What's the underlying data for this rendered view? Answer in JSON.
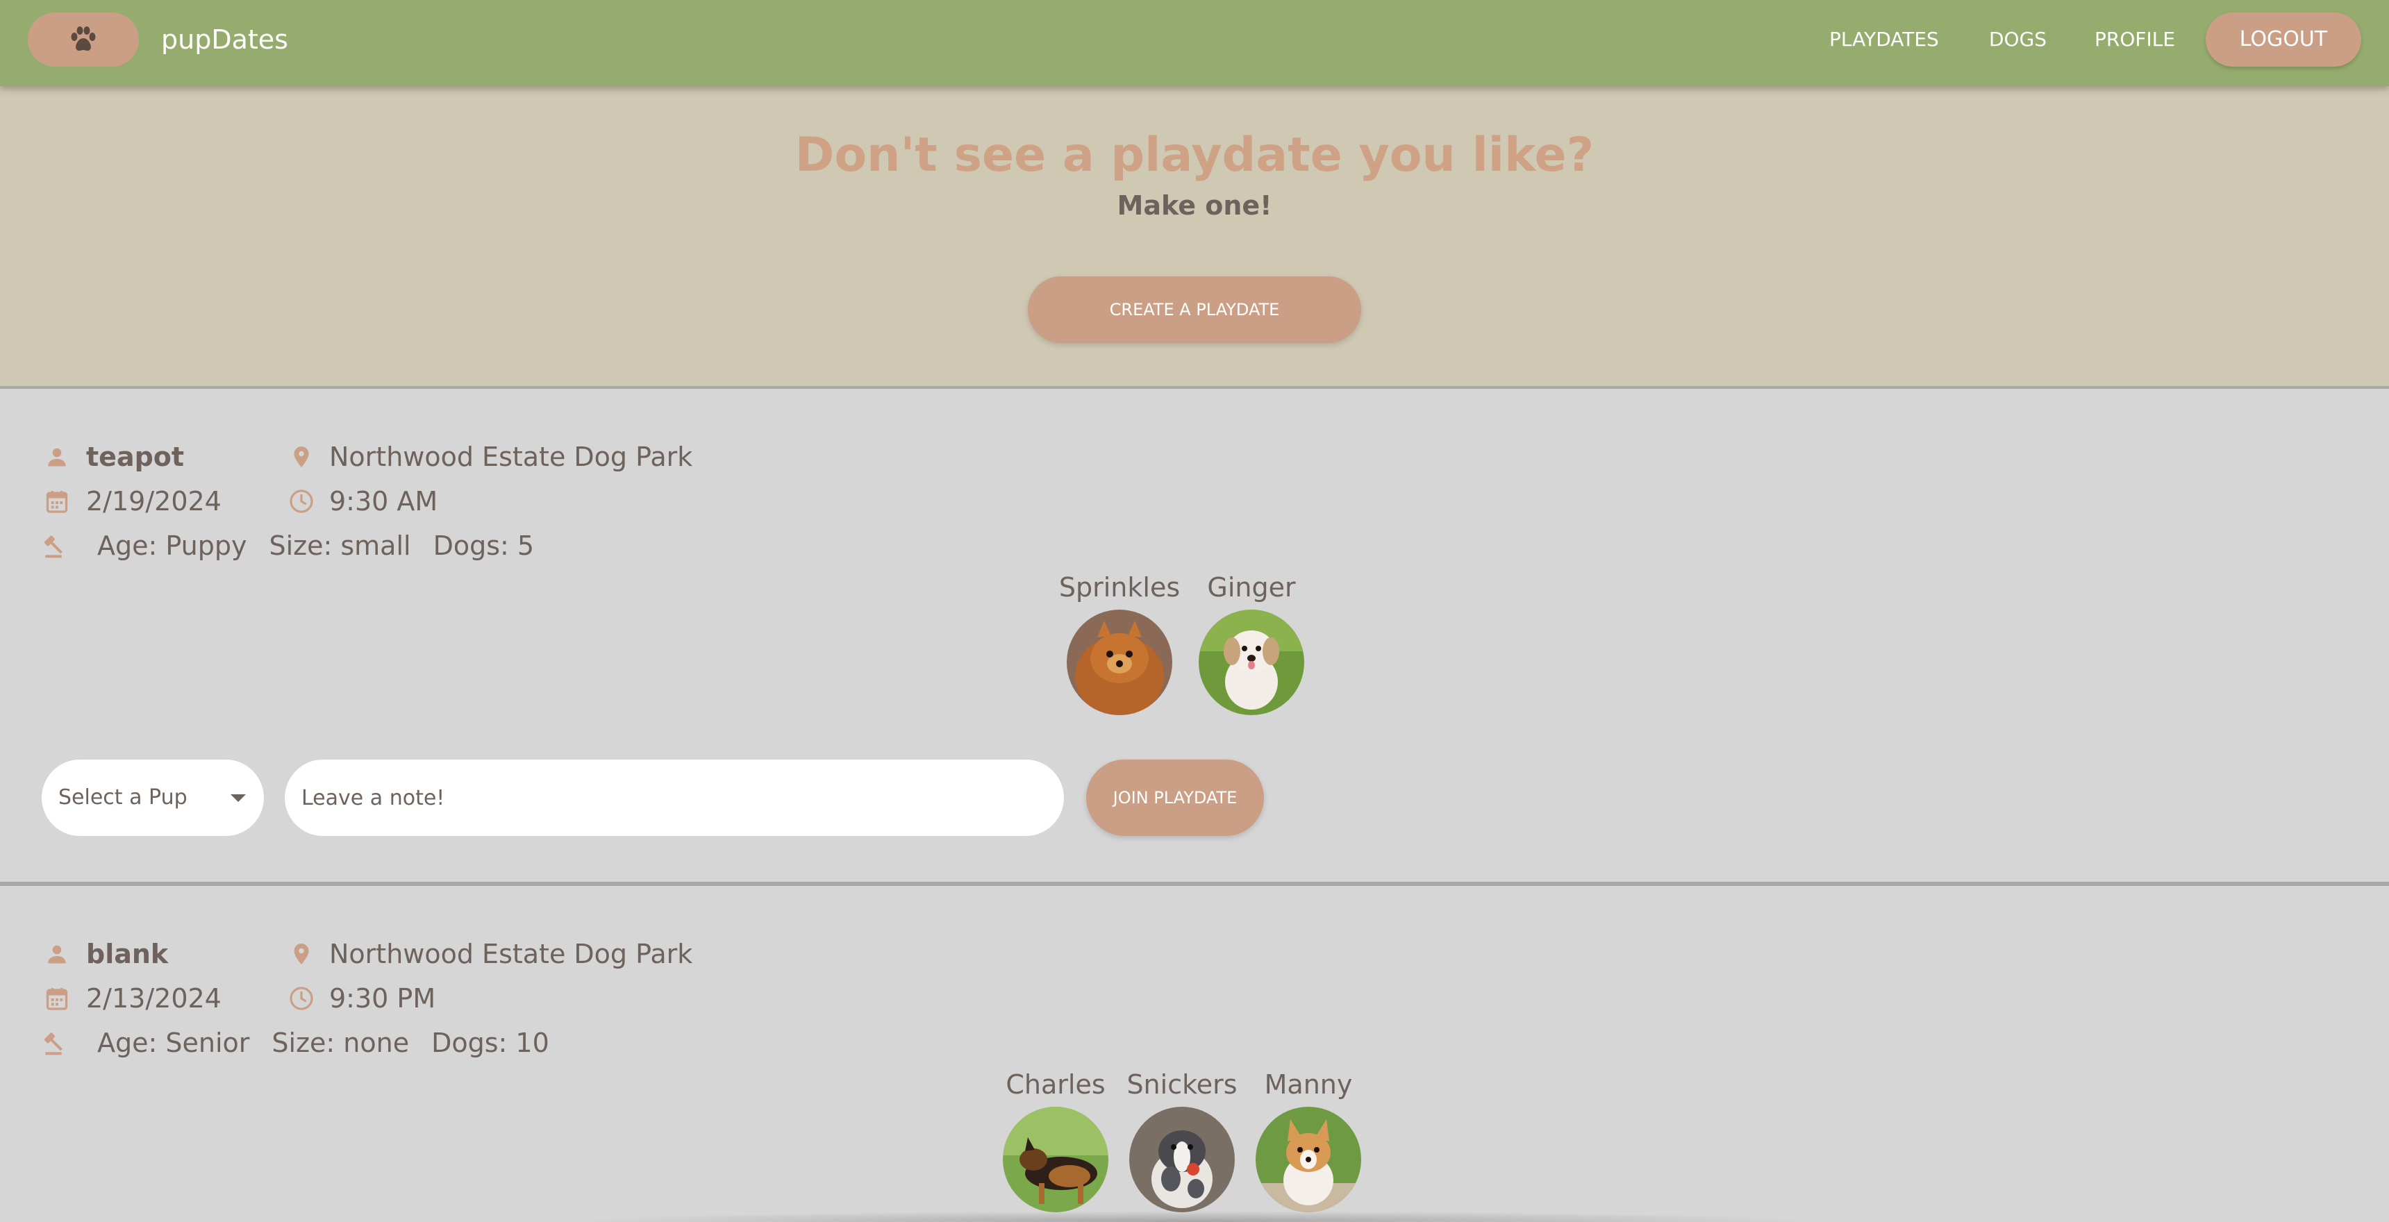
{
  "navbar": {
    "brand": "pupDates",
    "links": [
      "PLAYDATES",
      "DOGS",
      "PROFILE"
    ],
    "logout": "LOGOUT",
    "logo_icon": "paw-icon",
    "bg_color": "#96ac6e",
    "accent_color": "#cb9f85"
  },
  "hero": {
    "title": "Don't see a playdate you like?",
    "subtitle": "Make one!",
    "button": "CREATE A PLAYDATE"
  },
  "playdates": [
    {
      "host": "teapot",
      "location": "Northwood Estate Dog Park",
      "date": "2/19/2024",
      "time": "9:30 AM",
      "age": "Age: Puppy",
      "size": "Size: small",
      "dogs_count": "Dogs: 5",
      "dogs": [
        "Sprinkles",
        "Ginger"
      ],
      "select_placeholder": "Select a Pup",
      "note_placeholder": "Leave a note!",
      "join_button": "JOIN PLAYDATE"
    },
    {
      "host": "blank",
      "location": "Northwood Estate Dog Park",
      "date": "2/13/2024",
      "time": "9:30 PM",
      "age": "Age: Senior",
      "size": "Size: none",
      "dogs_count": "Dogs: 10",
      "dogs": [
        "Charles",
        "Snickers",
        "Manny"
      ]
    }
  ]
}
